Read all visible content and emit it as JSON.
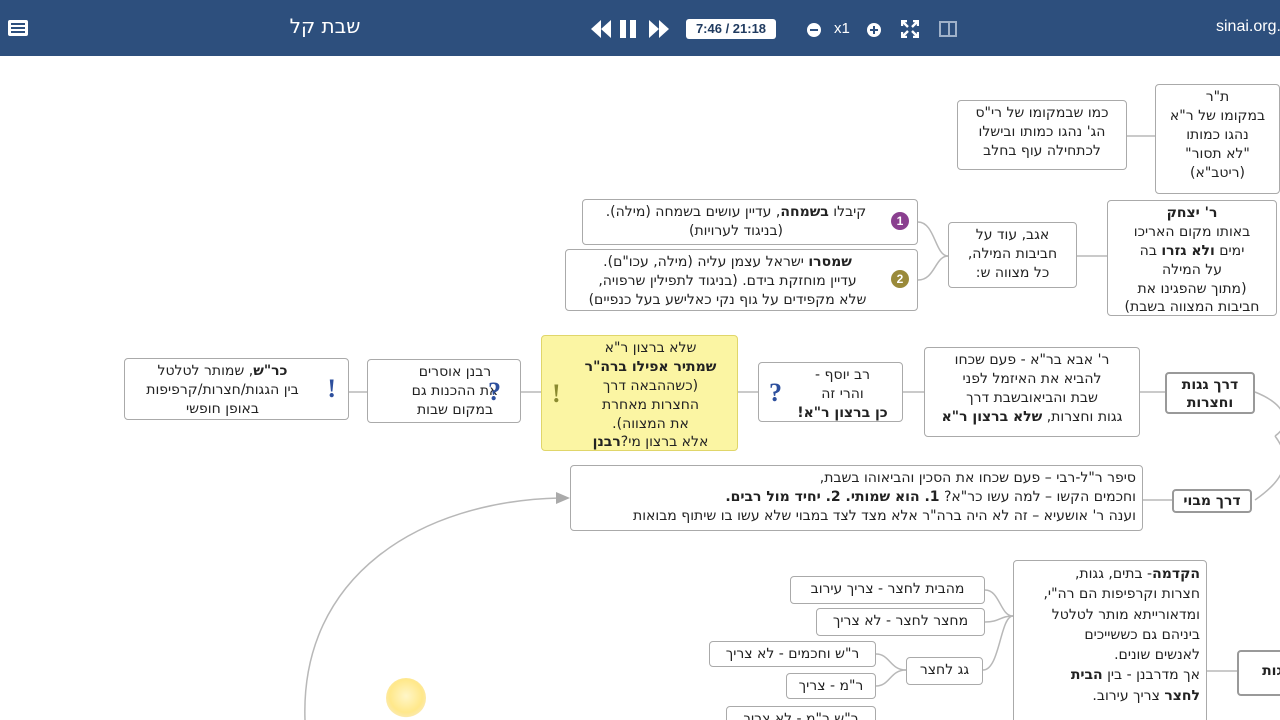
{
  "header": {
    "title": "שבת קל",
    "time": "7:46 / 21:18",
    "speed": "x1",
    "brand": "sinai.org.",
    "icons": [
      "menu-icon",
      "rewind-icon",
      "pause-icon",
      "fast-forward-icon",
      "zoom-out-icon",
      "zoom-in-icon",
      "fullscreen-icon",
      "split-view-icon"
    ]
  },
  "nodes": {
    "tr": {
      "l1": "ת\"ר",
      "l2": "במקומו של ר\"א",
      "l3": "נהגו כמותו",
      "l4": "\"לא תסור\"",
      "l5": "(ריטב\"א)"
    },
    "rys": {
      "l1": "כמו שבמקומו של רי\"ס",
      "l2": "הג' נהגו כמותו ובישלו",
      "l3": "לכתחילה עוף בחלב"
    },
    "ryitzchak": {
      "l1": "ר' יצחק",
      "l2": "באותו מקום האריכו",
      "l3a": "ימים ",
      "l3b": "ולא גזרו",
      "l3c": " בה",
      "l4": "על המילה",
      "l5": "(מתוך שהפגינו את",
      "l6": "חביבות המצווה בשבת)"
    },
    "agav": {
      "l1": "אגב, עוד על",
      "l2": "חביבות המילה,",
      "l3": "כל מצווה ש:"
    },
    "kiblu": {
      "l1a": "קיבלו ",
      "l1b": "בשמחה",
      "l1c": ", עדיין עושים בשמחה (מילה).",
      "l2": "(בניגוד לערויות)",
      "num": "1"
    },
    "shamru": {
      "l1a": "שמסרו",
      "l1b": " ישראל עצמן עליה (מילה, עכו\"ם).",
      "l2": "עדיין מוחזקת בידם. (בניגוד לתפילין שרפויה,",
      "l3": "שלא מקפידים על גוף נקי כאלישע בעל כנפיים)",
      "num": "2"
    },
    "abba": {
      "l1": "ר' אבא בר\"א - פעם שכחו",
      "l2": "להביא את האיזמל לפני",
      "l3": "שבת והביאובשבת דרך",
      "l4a": "גגות וחצרות, ",
      "l4b": "שלא ברצון ר\"א"
    },
    "yosef": {
      "l1": "רב יוסף -",
      "l2": "והרי זה",
      "l3": "כן ברצון ר\"א!"
    },
    "yellow": {
      "l1": "שלא ברצון ר\"א",
      "l2": "שמתיר אפילו ברה\"ר",
      "l3": "(כשההבאה דרך",
      "l4": "החצרות מאחרת",
      "l5": "את המצווה).",
      "l6a": "אלא ברצון מי?",
      "l6b": "רבנן"
    },
    "rabanan": {
      "l1": "רבנן אוסרים",
      "l2": "את ההכנות גם",
      "l3": "במקום שבות"
    },
    "krash": {
      "l1a": "כר\"ש",
      "l1b": ", שמותר לטלטל",
      "l2": "בין הגגות/חצרות/קרפיפות",
      "l3": "באופן חופשי"
    },
    "derech_gagot": {
      "l1": "דרך גגות",
      "l2": "וחצרות"
    },
    "derech_mavoi": {
      "l1": "דרך מבוי"
    },
    "sipper": {
      "l1": "סיפר ר\"ל-רבי – פעם שכחו את הסכין והביאוהו בשבת,",
      "l2a": "וחכמים הקשו – למה עשו כר\"א? ",
      "l2b": "1. הוא שמותי. 2. יחיד מול רבים.",
      "l3": "וענה ר' אושעיא – זה לא היה ברה\"ר אלא מצד לצד במבוי שלא עשו בו שיתוף מבואות"
    },
    "mebayit": {
      "l1": "מהבית לחצר - צריך עירוב"
    },
    "mechatzer": {
      "l1": "מחצר לחצר - לא צריך"
    },
    "gag": {
      "l1": "גג לחצר"
    },
    "rsh": {
      "l1": "ר\"ש וחכמים - לא צריך"
    },
    "rm": {
      "l1": "ר\"מ - צריך"
    },
    "rshrm": {
      "l1": "ר\"ש ר\"מ - לא צריך"
    },
    "hakdama": {
      "l1a": "הקדמה",
      "l1b": "- בתים, גגות,",
      "l2": "חצרות וקרפיפות הם רה\"י,",
      "l3": "ומדאורייתא מותר לטלטל",
      "l4": "ביניהם גם כששייכים",
      "l5": "לאנשים שונים.",
      "l6a": "אך מדרבנן - בין ",
      "l6b": "הבית",
      "l7a": "לחצר",
      "l7b": " צריך עירוב."
    },
    "gagot_edge": {
      "l1": "גגות"
    }
  }
}
